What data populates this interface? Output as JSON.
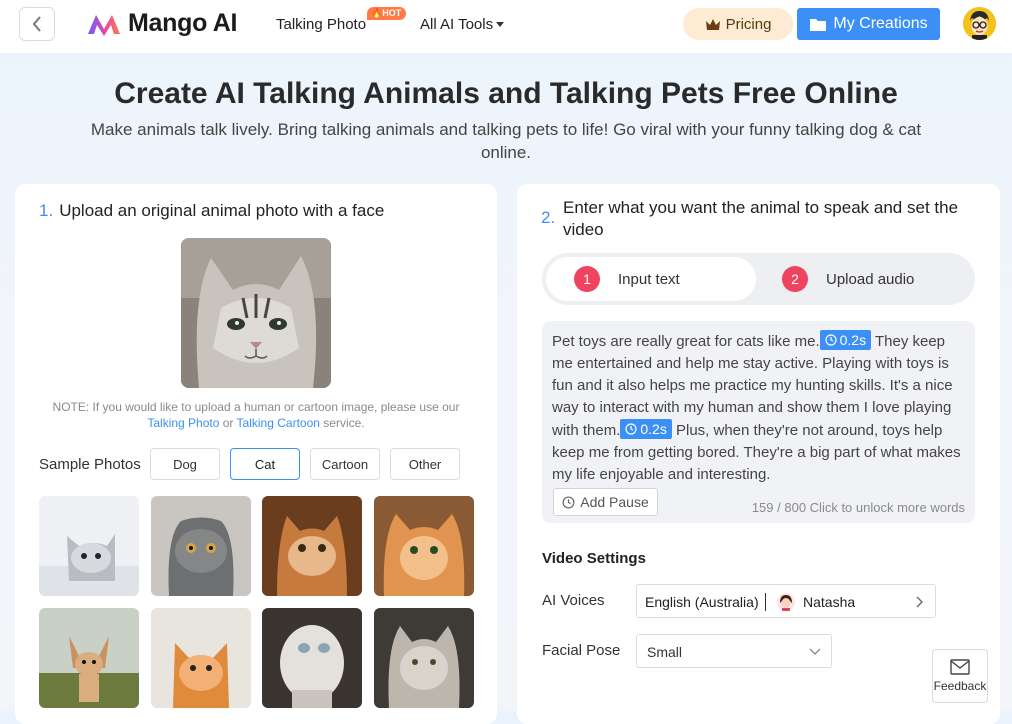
{
  "header": {
    "logo_text": "Mango AI",
    "nav_talking_photo": "Talking Photo",
    "hot_badge": "HOT",
    "nav_all_tools": "All AI Tools",
    "pricing": "Pricing",
    "my_creations": "My Creations"
  },
  "hero": {
    "title": "Create AI Talking Animals and Talking Pets Free Online",
    "subtitle": "Make animals talk lively. Bring talking animals and talking pets to life! Go viral with your funny talking dog & cat online."
  },
  "step1": {
    "number": "1.",
    "title": "Upload an original animal photo with a face",
    "note_prefix": "NOTE: If you would like to upload a human or cartoon image, please use our",
    "note_link1": "Talking Photo",
    "note_or": "or",
    "note_link2": "Talking Cartoon",
    "note_suffix": "service.",
    "sample_label": "Sample Photos",
    "sample_tabs": [
      "Dog",
      "Cat",
      "Cartoon",
      "Other"
    ],
    "active_sample_tab": "Cat"
  },
  "step2": {
    "number": "2.",
    "title": "Enter what you want the animal to speak and set the video",
    "tabs": [
      {
        "num": "1",
        "label": "Input text"
      },
      {
        "num": "2",
        "label": "Upload audio"
      }
    ],
    "script_part1": "Pet toys are really great for cats like me.",
    "pause1": "0.2s",
    "script_part2": " They keep me entertained and help me stay active. Playing with toys is fun and it also helps me practice my hunting skills. It's a nice way to interact with my human and show them I love playing with them.",
    "pause2": "0.2s",
    "script_part3": " Plus, when they're not around, toys help keep me from getting bored. They're a big part of what makes my life enjoyable and interesting.",
    "add_pause": "Add Pause",
    "word_count": "159 / 800",
    "unlock": "Click to unlock more words"
  },
  "video_settings": {
    "title": "Video Settings",
    "ai_voices_label": "AI Voices",
    "voice_language": "English (Australia)",
    "voice_name": "Natasha",
    "facial_pose_label": "Facial Pose",
    "facial_pose_value": "Small"
  },
  "feedback": "Feedback",
  "colors": {
    "accent": "#3b8ff5",
    "tab_number": "#f0435f",
    "pricing_bg": "#fdebd3",
    "hot_badge": "#ff7a45"
  },
  "icons": [
    "back-arrow-icon",
    "mango-logo-icon",
    "caret-down-icon",
    "crown-icon",
    "folder-icon",
    "clock-icon",
    "chevron-right-icon",
    "chevron-down-icon",
    "message-icon"
  ]
}
